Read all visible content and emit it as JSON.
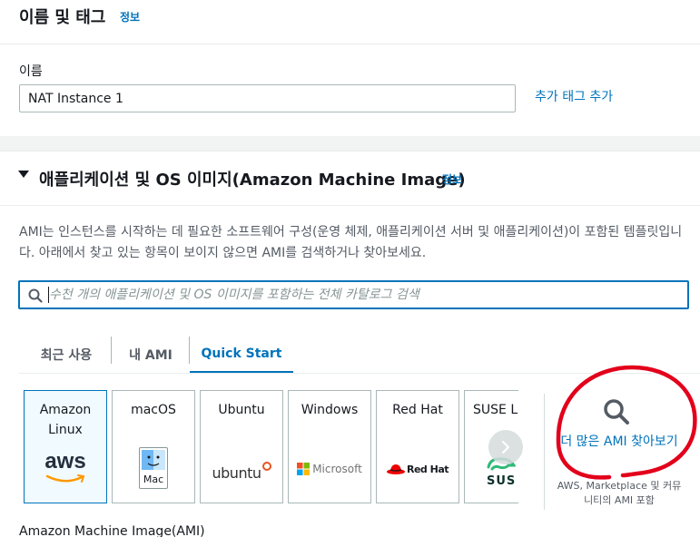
{
  "name_section": {
    "title": "이름 및 태그",
    "info": "정보",
    "name_label": "이름",
    "name_value": "NAT Instance 1",
    "add_tags": "추가 태그 추가"
  },
  "ami_section": {
    "title": "애플리케이션 및 OS 이미지(Amazon Machine Image)",
    "info": "정보",
    "description": "AMI는 인스턴스를 시작하는 데 필요한 소프트웨어 구성(운영 체제, 애플리케이션 서버 및 애플리케이션)이 포함된 템플릿입니다. 아래에서 찾고 있는 항목이 보이지 않으면 AMI를 검색하거나 찾아보세요.",
    "search_placeholder": "수천 개의 애플리케이션 및 OS 이미지를 포함하는 전체 카탈로그 검색",
    "tabs": [
      {
        "label": "최근 사용",
        "active": false
      },
      {
        "label": "내 AMI",
        "active": false
      },
      {
        "label": "Quick Start",
        "active": true
      }
    ],
    "cards": [
      {
        "title": "Amazon Linux",
        "logo": "aws-logo",
        "logo_text": "aws",
        "selected": true
      },
      {
        "title": "macOS",
        "logo": "mac-logo",
        "logo_text": "Mac",
        "selected": false
      },
      {
        "title": "Ubuntu",
        "logo": "ubuntu-logo",
        "logo_text": "ubuntu",
        "selected": false
      },
      {
        "title": "Windows",
        "logo": "microsoft-logo",
        "logo_text": "Microsoft",
        "selected": false
      },
      {
        "title": "Red Hat",
        "logo": "redhat-logo",
        "logo_text": "Red Hat",
        "selected": false
      },
      {
        "title": "SUSE Li",
        "logo": "suse-logo",
        "logo_text": "SUS",
        "selected": false
      }
    ],
    "browse_more": "더 많은 AMI 찾아보기",
    "browse_more_sub": "AWS, Marketplace 및 커뮤니티의 AMI 포함",
    "ami_label": "Amazon Machine Image(AMI)"
  },
  "colors": {
    "accent": "#0073bb",
    "annotation": "#e3001b",
    "aws_orange": "#ff9900",
    "ubuntu_orange": "#e95420",
    "redhat_red": "#ee0000",
    "suse_green": "#30ba78"
  }
}
